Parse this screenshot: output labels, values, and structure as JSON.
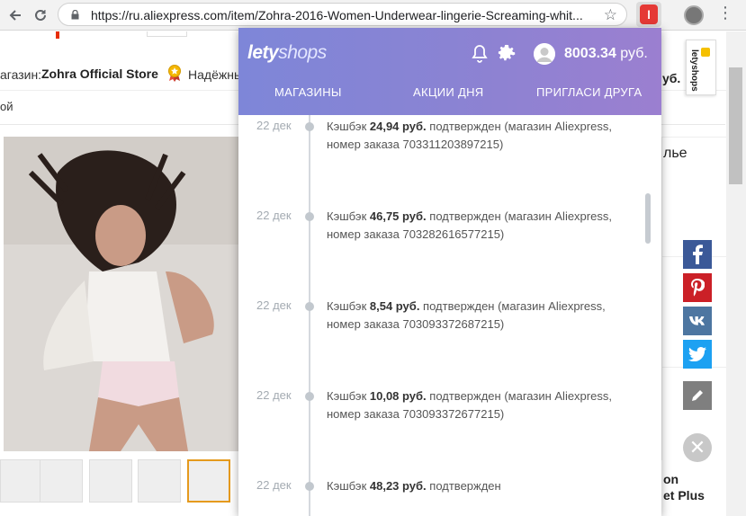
{
  "browser": {
    "url": "https://ru.aliexpress.com/item/Zohra-2016-Women-Underwear-lingerie-Screaming-whit...",
    "back_icon": "arrow-left-icon",
    "reload_icon": "reload-icon",
    "lock_icon": "lock-icon",
    "bookmark_icon": "star-icon",
    "extension_label": "l",
    "menu_icon": "vertical-dots-icon"
  },
  "page": {
    "store_label": "агазин:",
    "store_name": "Zohra Official Store",
    "trust_label": "Надёжны",
    "breadcrumb_fragment": "ой",
    "right_title_fragment": "лье",
    "ruble_fragment": "уб.",
    "right_bottom_fragment_1": "on",
    "right_bottom_fragment_2": "et Plus",
    "side_tab_label": "letyshops",
    "social": [
      "facebook-icon",
      "pinterest-icon",
      "vk-icon",
      "twitter-icon",
      "pencil-icon"
    ],
    "social_colors": {
      "facebook": "#3b5998",
      "pinterest": "#cb2027",
      "vk": "#4d76a1",
      "twitter": "#1da1f2",
      "pencil": "#7f7f7f"
    }
  },
  "popup": {
    "logo_part1": "lety",
    "logo_part2": "shops",
    "balance_amount": "8003.34",
    "balance_currency": "руб.",
    "tabs": [
      "МАГАЗИНЫ",
      "АКЦИИ ДНЯ",
      "ПРИГЛАСИ ДРУГА"
    ],
    "gradient_colors": [
      "#7e86d8",
      "#9b7fd0"
    ],
    "entries": [
      {
        "date": "22 дек",
        "prefix": "Кэшбэк ",
        "amount": "24,94 руб.",
        "suffix": " подтвержден (магазин Aliexpress, номер заказа 703311203897215)"
      },
      {
        "date": "22 дек",
        "prefix": "Кэшбэк ",
        "amount": "46,75 руб.",
        "suffix": " подтвержден (магазин Aliexpress, номер заказа 703282616577215)"
      },
      {
        "date": "22 дек",
        "prefix": "Кэшбэк ",
        "amount": "8,54 руб.",
        "suffix": " подтвержден (магазин Aliexpress, номер заказа 703093372687215)"
      },
      {
        "date": "22 дек",
        "prefix": "Кэшбэк ",
        "amount": "10,08 руб.",
        "suffix": " подтвержден (магазин Aliexpress, номер заказа 703093372677215)"
      },
      {
        "date": "22 дек",
        "prefix": "Кэшбэк ",
        "amount": "48,23 руб.",
        "suffix": " подтвержден"
      }
    ]
  }
}
